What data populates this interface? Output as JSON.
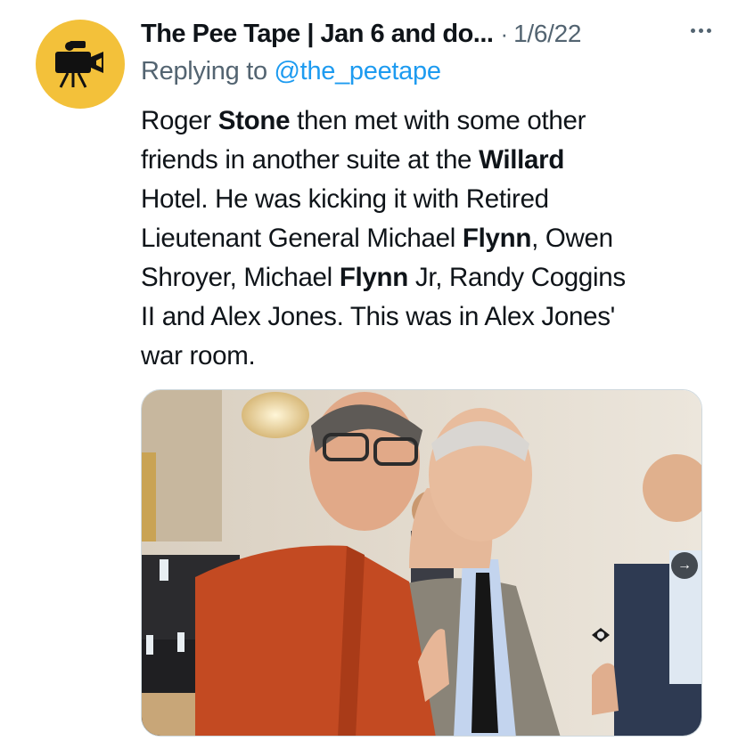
{
  "tweet": {
    "author_name": "The Pee Tape | Jan 6 and do...",
    "separator": "·",
    "date": "1/6/22",
    "reply_prefix": "Replying to ",
    "reply_handle": "@the_peetape",
    "lines": [
      [
        {
          "t": "Roger ",
          "b": false
        },
        {
          "t": "Stone",
          "b": true
        },
        {
          "t": " then met with some other",
          "b": false
        }
      ],
      [
        {
          "t": "friends in another suite at the ",
          "b": false
        },
        {
          "t": "Willard",
          "b": true
        }
      ],
      [
        {
          "t": "Hotel. He was kicking it with Retired",
          "b": false
        }
      ],
      [
        {
          "t": "Lieutenant General Michael ",
          "b": false
        },
        {
          "t": "Flynn",
          "b": true
        },
        {
          "t": ", Owen",
          "b": false
        }
      ],
      [
        {
          "t": "Shroyer, Michael ",
          "b": false
        },
        {
          "t": "Flynn",
          "b": true
        },
        {
          "t": " Jr, Randy Coggins",
          "b": false
        }
      ],
      [
        {
          "t": "II and Alex Jones. This was in Alex Jones'",
          "b": false
        }
      ],
      [
        {
          "t": "war room.",
          "b": false
        }
      ]
    ]
  },
  "icons": {
    "avatar": "movie-camera-icon",
    "more": "more-options-icon",
    "next": "arrow-right-icon"
  },
  "colors": {
    "avatar_bg": "#f3c13a",
    "link": "#1d9bf0",
    "secondary_text": "#536471"
  }
}
